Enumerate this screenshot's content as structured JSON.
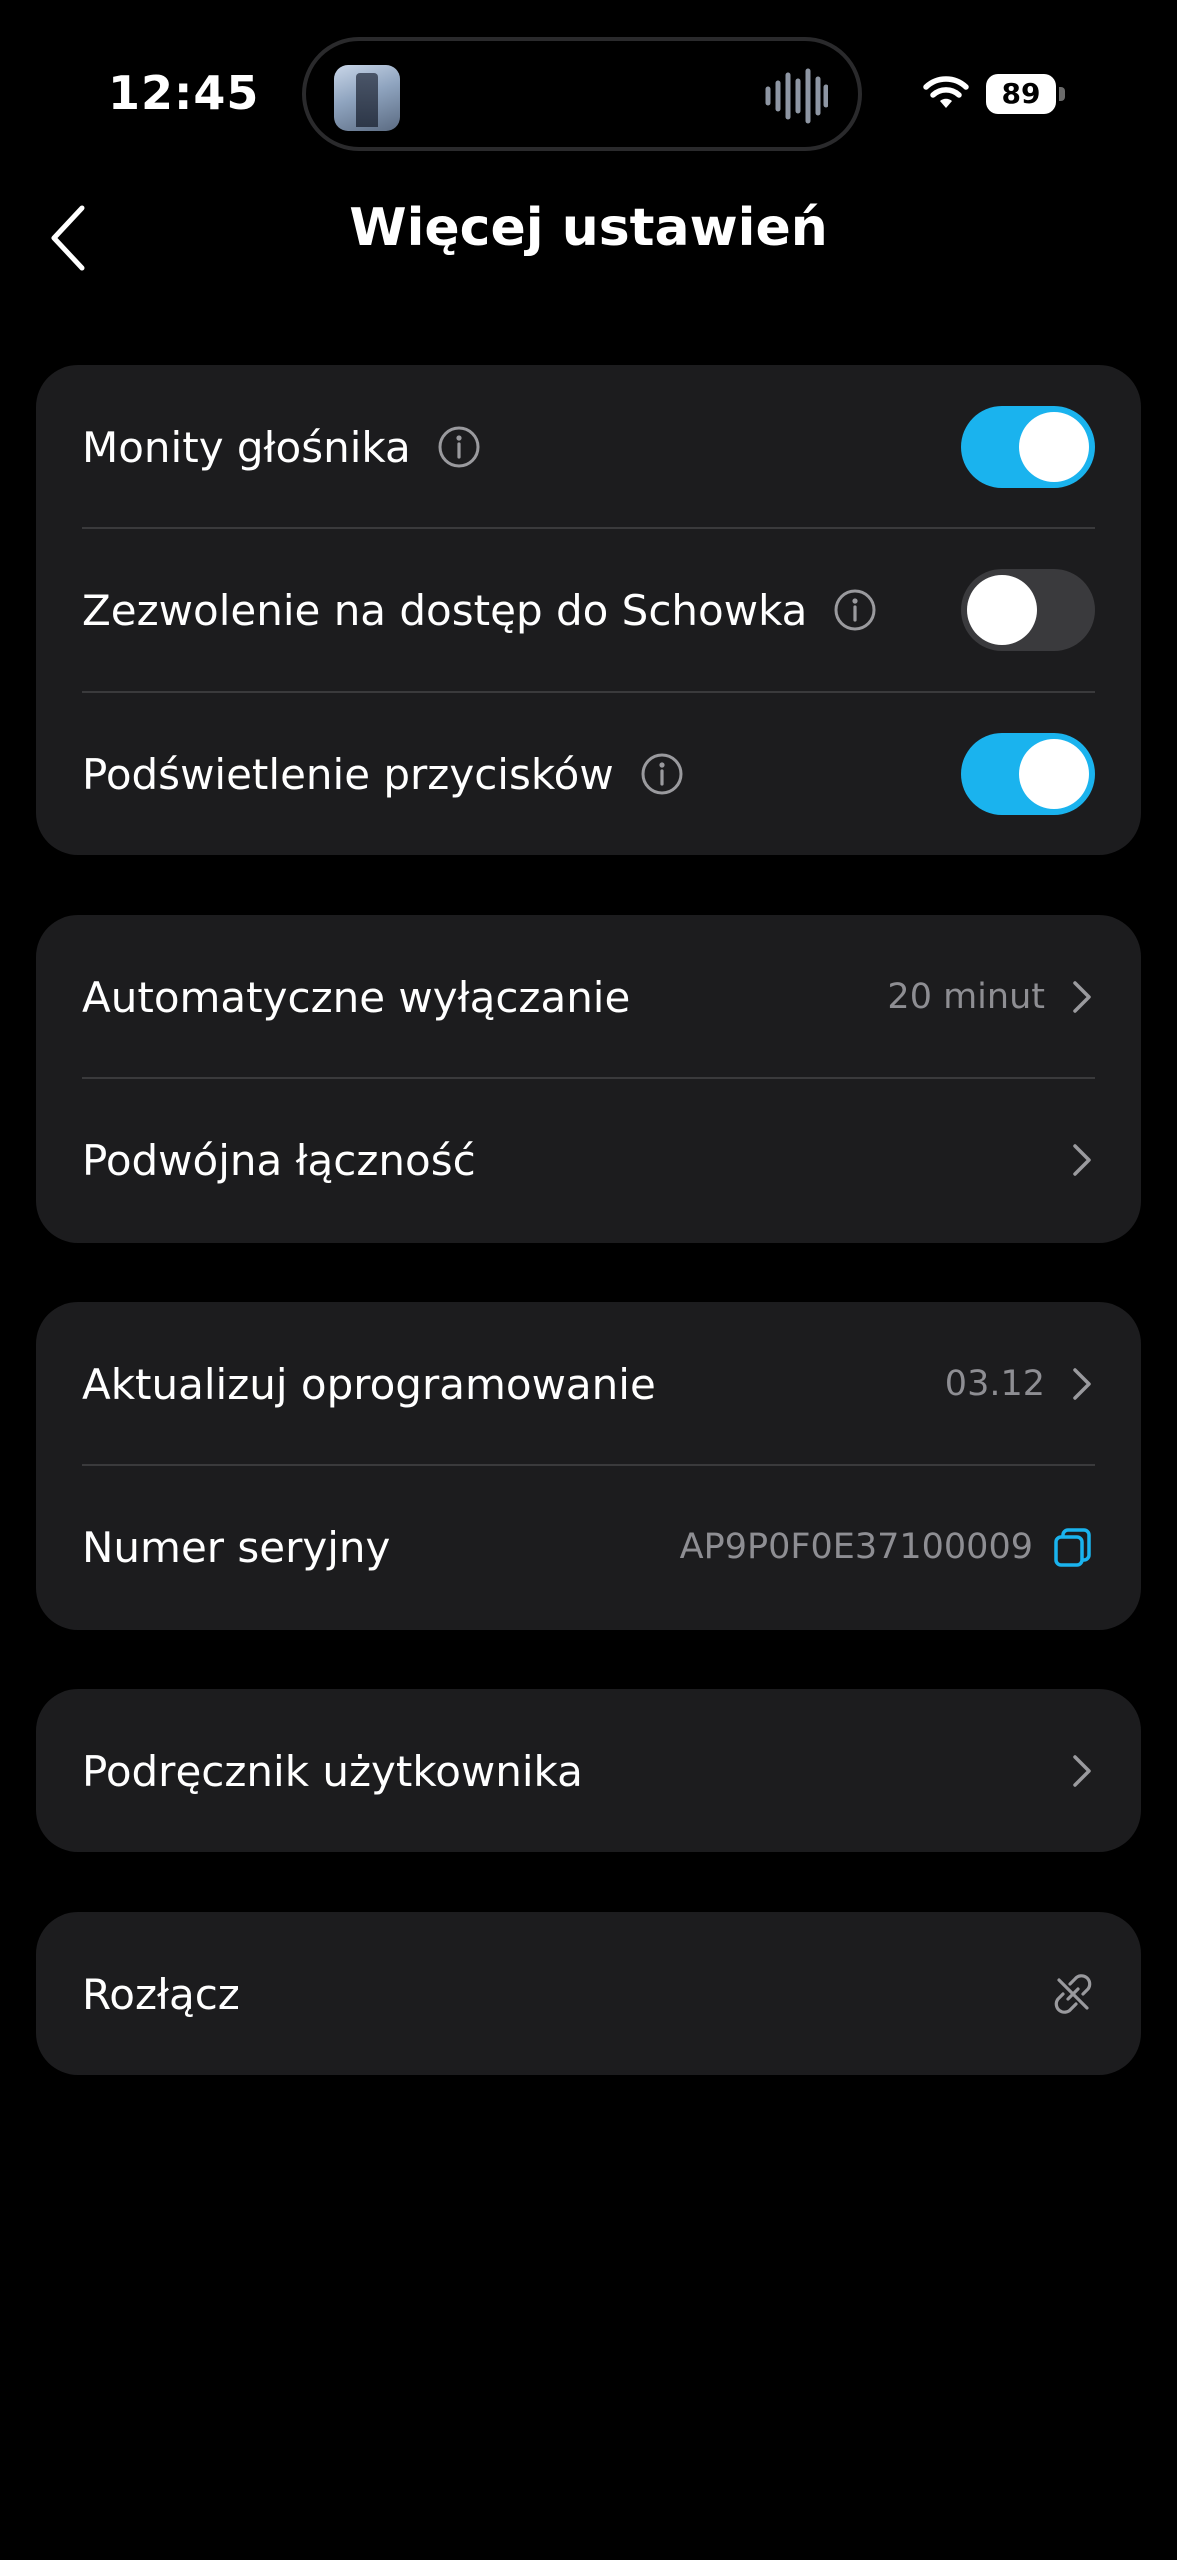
{
  "status_bar": {
    "time": "12:45",
    "battery": "89",
    "icons": [
      "now-playing-thumbnail",
      "audio-wave-icon",
      "wifi-icon",
      "battery-icon"
    ]
  },
  "header": {
    "title": "Więcej ustawień",
    "back_icon": "chevron-left-icon"
  },
  "toggles_card": {
    "items": [
      {
        "label": "Monity głośnika",
        "enabled": true
      },
      {
        "label": "Zezwolenie na dostęp do Schowka",
        "enabled": false
      },
      {
        "label": "Podświetlenie przycisków",
        "enabled": true
      }
    ]
  },
  "connection_card": {
    "items": [
      {
        "label": "Automatyczne wyłączanie",
        "value": "20 minut"
      },
      {
        "label": "Podwójna łączność",
        "value": ""
      }
    ]
  },
  "device_card": {
    "firmware": {
      "label": "Aktualizuj oprogramowanie",
      "value": "03.12"
    },
    "serial": {
      "label": "Numer seryjny",
      "value": "AP9P0F0E37100009"
    }
  },
  "manual_card": {
    "label": "Podręcznik użytkownika"
  },
  "disconnect_card": {
    "label": "Rozłącz"
  },
  "colors": {
    "background": "#000000",
    "card": "#1c1c1e",
    "accent": "#1ab3ee",
    "secondary_text": "#8e8e93"
  }
}
